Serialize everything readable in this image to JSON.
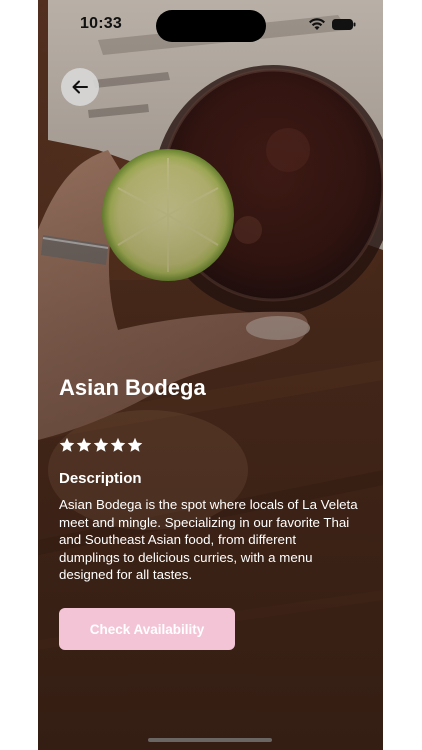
{
  "status_bar": {
    "time": "10:33",
    "icons": [
      "wifi-icon",
      "battery-icon"
    ]
  },
  "back_button": {
    "icon": "arrow-left-icon"
  },
  "restaurant": {
    "name": "Asian Bodega",
    "rating": 5,
    "rating_max": 5,
    "description_heading": "Description",
    "description": "Asian Bodega is the spot where locals of La Veleta meet and mingle. Specializing in our favorite Thai and Southeast Asian food, from different dumplings to delicious curries, with a menu designed for all tastes."
  },
  "cta": {
    "label": "Check Availability"
  },
  "colors": {
    "cta_background": "#f3c4d6",
    "text": "#ffffff",
    "back_button_background": "#d7d7d7"
  }
}
